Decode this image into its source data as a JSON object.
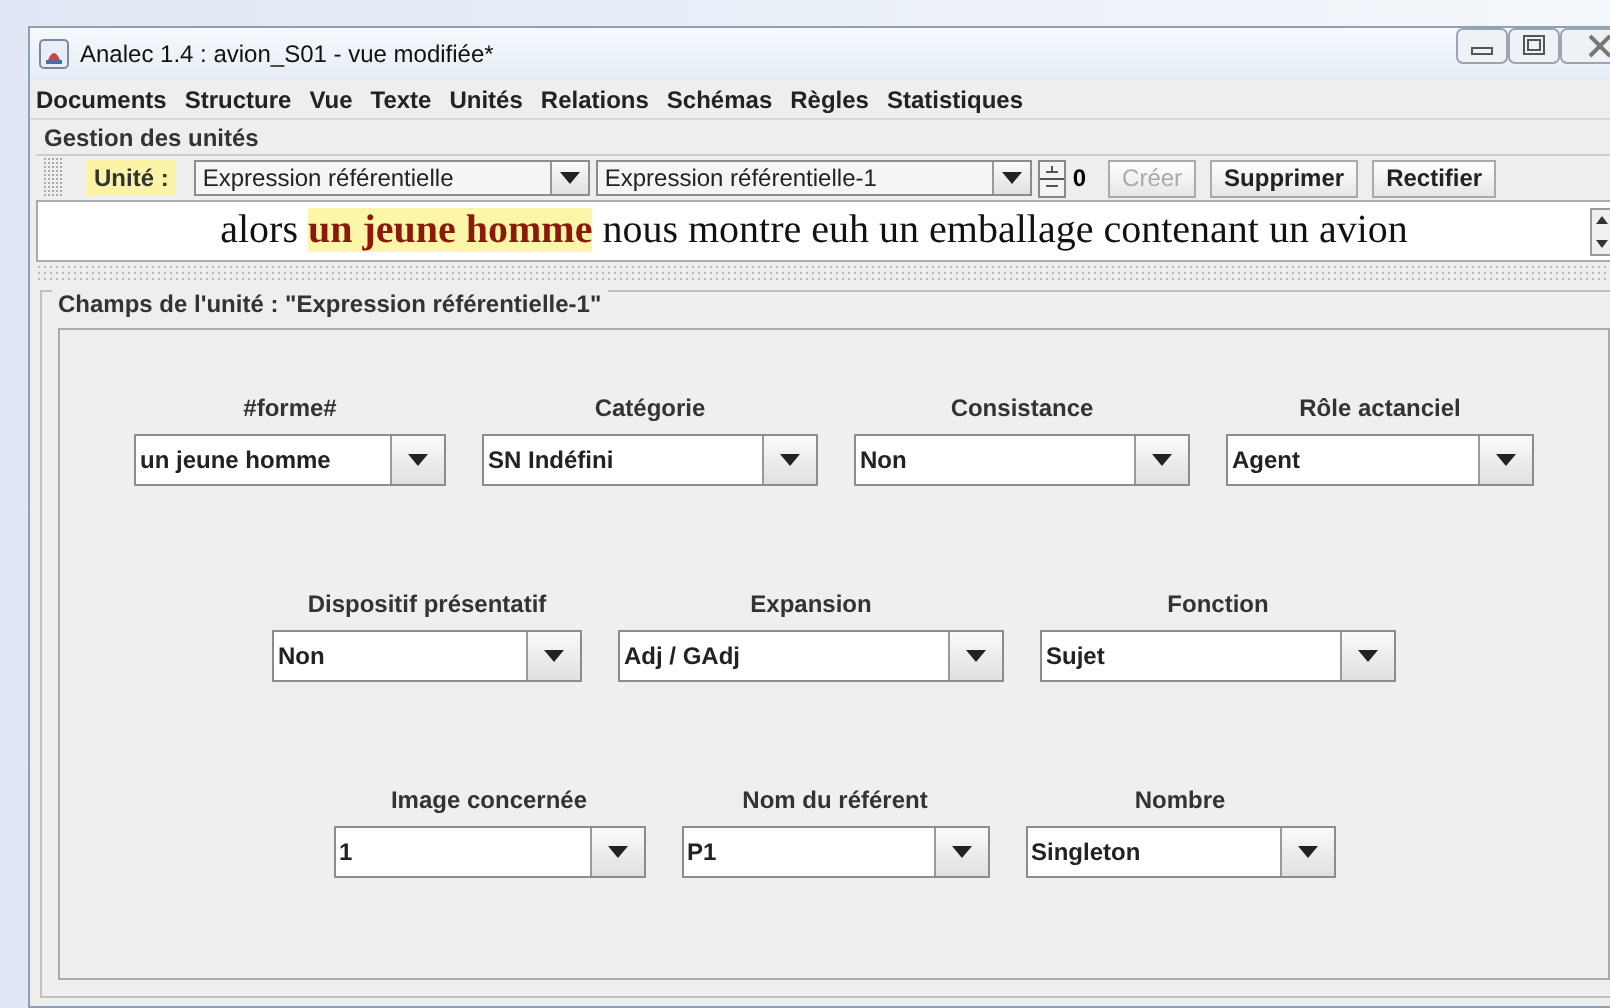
{
  "window": {
    "title": "Analec 1.4 : avion_S01 - vue modifiée*"
  },
  "menu": [
    "Documents",
    "Structure",
    "Vue",
    "Texte",
    "Unités",
    "Relations",
    "Schémas",
    "Règles",
    "Statistiques"
  ],
  "section_title": "Gestion des unités",
  "toolbar": {
    "label": "Unité :",
    "type_combo": "Expression référentielle",
    "unit_combo": "Expression référentielle-1",
    "spinner": "0",
    "buttons": [
      {
        "label": "Créer",
        "disabled": true
      },
      {
        "label": "Supprimer",
        "disabled": false
      },
      {
        "label": "Rectifier",
        "disabled": false
      }
    ]
  },
  "text_line": [
    {
      "text": "alors ",
      "highlighted": false
    },
    {
      "text": "un jeune homme",
      "highlighted": true
    },
    {
      "text": " nous montre euh un emballage contenant un avion",
      "highlighted": false
    }
  ],
  "panel": {
    "title": "Champs de l'unité :  \"Expression référentielle-1\"",
    "rows": [
      [
        {
          "label": "#forme#",
          "value": "un jeune homme"
        },
        {
          "label": "Catégorie",
          "value": "SN Indéfini"
        },
        {
          "label": "Consistance",
          "value": "Non"
        },
        {
          "label": "Rôle actanciel",
          "value": "Agent"
        }
      ],
      [
        {
          "label": "Dispositif présentatif",
          "value": "Non"
        },
        {
          "label": "Expansion",
          "value": "Adj / GAdj"
        },
        {
          "label": "Fonction",
          "value": "Sujet"
        }
      ],
      [
        {
          "label": "Image concernée",
          "value": "1"
        },
        {
          "label": "Nom du référent",
          "value": "P1"
        },
        {
          "label": "Nombre",
          "value": "Singleton"
        }
      ]
    ]
  }
}
